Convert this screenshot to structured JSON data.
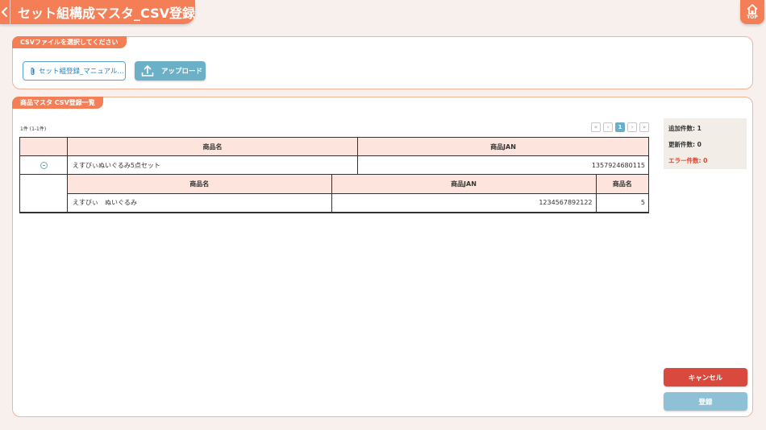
{
  "header": {
    "title": "セット組構成マスタ_CSV登録",
    "top_label": "TOP"
  },
  "file_panel": {
    "label": "CSVファイルを選択してください",
    "file_button": "セット組登録_マニュアル...",
    "upload_button": "アップロード"
  },
  "list_panel": {
    "label": "商品マスタ CSV登録一覧",
    "count_text": "1件 (1-1件)",
    "pager": {
      "first": "«",
      "prev": "‹",
      "page": "1",
      "next": "›",
      "last": "»"
    },
    "columns": {
      "name": "商品名",
      "jan": "商品JAN"
    },
    "row": {
      "name": "えすびぃぬいぐるみ5点セット",
      "jan": "1357924680115"
    },
    "sub_columns": {
      "name": "商品名",
      "jan": "商品JAN",
      "qty": "商品名"
    },
    "sub_row": {
      "name": "えすびぃ　ぬいぐるみ",
      "jan": "1234567892122",
      "qty": "5"
    }
  },
  "summary": {
    "added": "追加件数: 1",
    "updated": "更新件数: 0",
    "errors": "エラー件数: 0"
  },
  "actions": {
    "cancel": "キャンセル",
    "register": "登録"
  },
  "colors": {
    "accent": "#f47f57",
    "teal": "#6cb0c8",
    "danger": "#d9493d",
    "error_text": "#e0422c"
  }
}
